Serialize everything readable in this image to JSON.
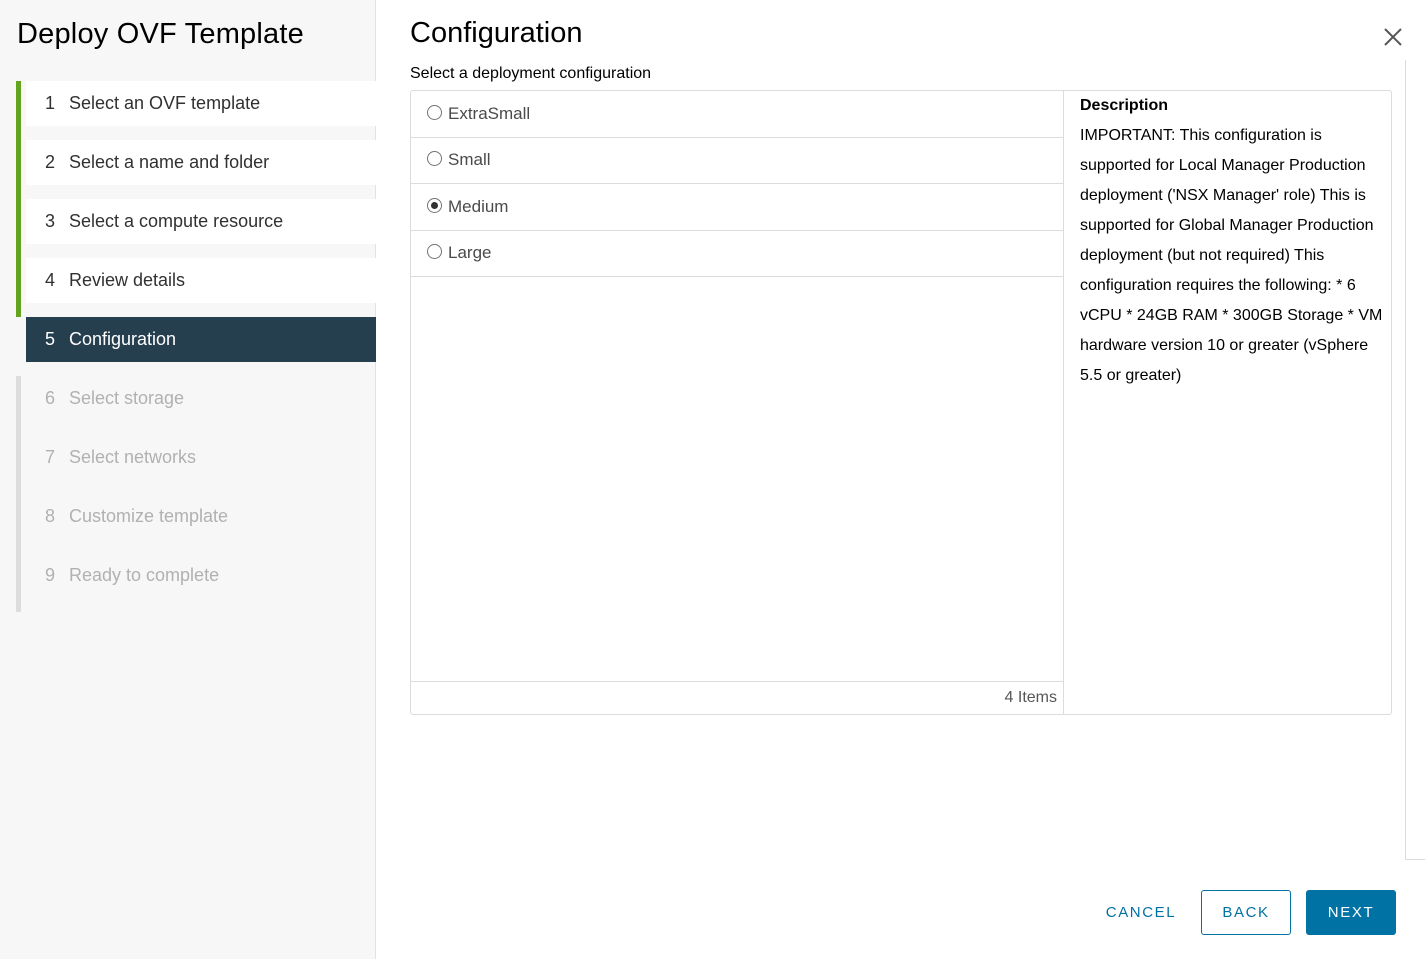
{
  "wizard": {
    "title": "Deploy OVF Template",
    "steps": [
      {
        "num": "1",
        "label": "Select an OVF template",
        "state": "done"
      },
      {
        "num": "2",
        "label": "Select a name and folder",
        "state": "done"
      },
      {
        "num": "3",
        "label": "Select a compute resource",
        "state": "done"
      },
      {
        "num": "4",
        "label": "Review details",
        "state": "done"
      },
      {
        "num": "5",
        "label": "Configuration",
        "state": "active"
      },
      {
        "num": "6",
        "label": "Select storage",
        "state": "todo"
      },
      {
        "num": "7",
        "label": "Select networks",
        "state": "todo"
      },
      {
        "num": "8",
        "label": "Customize template",
        "state": "todo"
      },
      {
        "num": "9",
        "label": "Ready to complete",
        "state": "todo"
      }
    ]
  },
  "main": {
    "title": "Configuration",
    "subtitle": "Select a deployment configuration",
    "options": [
      {
        "label": "ExtraSmall",
        "selected": false
      },
      {
        "label": "Small",
        "selected": false
      },
      {
        "label": "Medium",
        "selected": true
      },
      {
        "label": "Large",
        "selected": false
      }
    ],
    "item_count": "4 Items",
    "description": {
      "heading": "Description",
      "text": "IMPORTANT: This configuration is supported for Local Manager Production deployment ('NSX Manager' role) This is supported for Global Manager Production deployment (but not required) This configuration requires the following: * 6 vCPU * 24GB RAM * 300GB Storage * VM hardware version 10 or greater (vSphere 5.5 or greater)"
    }
  },
  "buttons": {
    "cancel": "CANCEL",
    "back": "BACK",
    "next": "NEXT"
  },
  "icons": {
    "close": "close-icon"
  },
  "colors": {
    "accent": "#0072a3",
    "completed_step": "#62a420",
    "active_step_bg": "#263f4f"
  }
}
